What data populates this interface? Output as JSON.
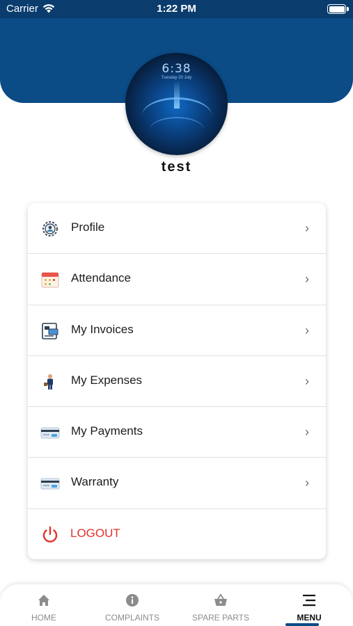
{
  "status_bar": {
    "carrier": "Carrier",
    "time": "1:22 PM"
  },
  "avatar": {
    "clock": "6:38",
    "date": "Tuesday 20 July"
  },
  "user": {
    "name": "test"
  },
  "menu": {
    "items": [
      {
        "label": "Profile",
        "icon": "profile-gear-icon"
      },
      {
        "label": "Attendance",
        "icon": "calendar-icon"
      },
      {
        "label": "My Invoices",
        "icon": "invoice-icon"
      },
      {
        "label": "My Expenses",
        "icon": "businessman-icon"
      },
      {
        "label": "My Payments",
        "icon": "credit-card-icon"
      },
      {
        "label": "Warranty",
        "icon": "credit-card-icon"
      }
    ],
    "logout": {
      "label": "LOGOUT",
      "icon": "power-icon",
      "color": "#e0322b"
    }
  },
  "bottom_nav": {
    "items": [
      {
        "label": "HOME",
        "icon": "home-icon"
      },
      {
        "label": "COMPLAINTS",
        "icon": "info-icon"
      },
      {
        "label": "SPARE PARTS",
        "icon": "basket-icon"
      },
      {
        "label": "MENU",
        "icon": "menu-icon",
        "active": true
      }
    ]
  },
  "colors": {
    "header": "#0b4b86",
    "accent": "#0b4b86",
    "logout": "#e0322b"
  }
}
